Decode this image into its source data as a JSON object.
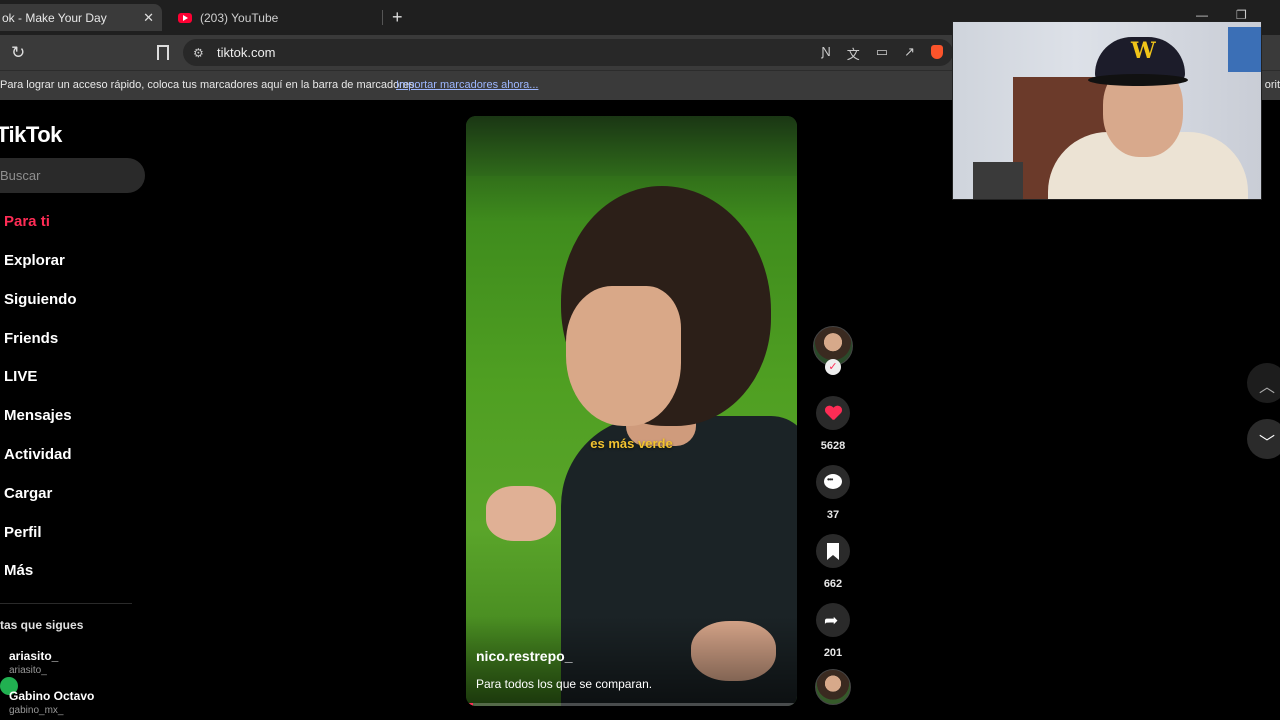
{
  "browser": {
    "tabs": [
      {
        "title": "ok - Make Your Day",
        "active": true
      },
      {
        "title": "(203) YouTube",
        "active": false
      }
    ],
    "url": "tiktok.com",
    "bookmarks_bar": {
      "message": "Para lograr un acceso rápido, coloca tus marcadores aquí en la barra de marcadores.",
      "import_link": "Importar marcadores ahora...",
      "right_text": "orit"
    }
  },
  "tiktok": {
    "logo": "TikTok",
    "search_placeholder": "Buscar",
    "nav": [
      "Para ti",
      "Explorar",
      "Siguiendo",
      "Friends",
      "LIVE",
      "Mensajes",
      "Actividad",
      "Cargar",
      "Perfil",
      "Más"
    ],
    "active_nav": "Para ti",
    "following_header": "tas que sigues",
    "following": [
      {
        "name": "ariasito_",
        "handle": "ariasito_"
      },
      {
        "name": "Gabino Octavo",
        "handle": "gabino_mx_"
      }
    ]
  },
  "video": {
    "caption_overlay": "es más verde",
    "username": "nico.restrepo_",
    "description": "Para todos los que se comparan.",
    "progress_fraction": 0.02
  },
  "actions": {
    "likes": "5628",
    "comments": "37",
    "saves": "662",
    "shares": "201"
  },
  "colors": {
    "accent": "#fe2c55",
    "caption": "#f2c230",
    "link": "#9db7ff"
  },
  "icons": [
    "reload-icon",
    "bookmark-icon",
    "site-settings-icon",
    "heart-icon",
    "comment-icon",
    "save-icon",
    "share-icon",
    "chevron-up-icon",
    "chevron-down-icon",
    "youtube-icon",
    "brave-icon"
  ]
}
